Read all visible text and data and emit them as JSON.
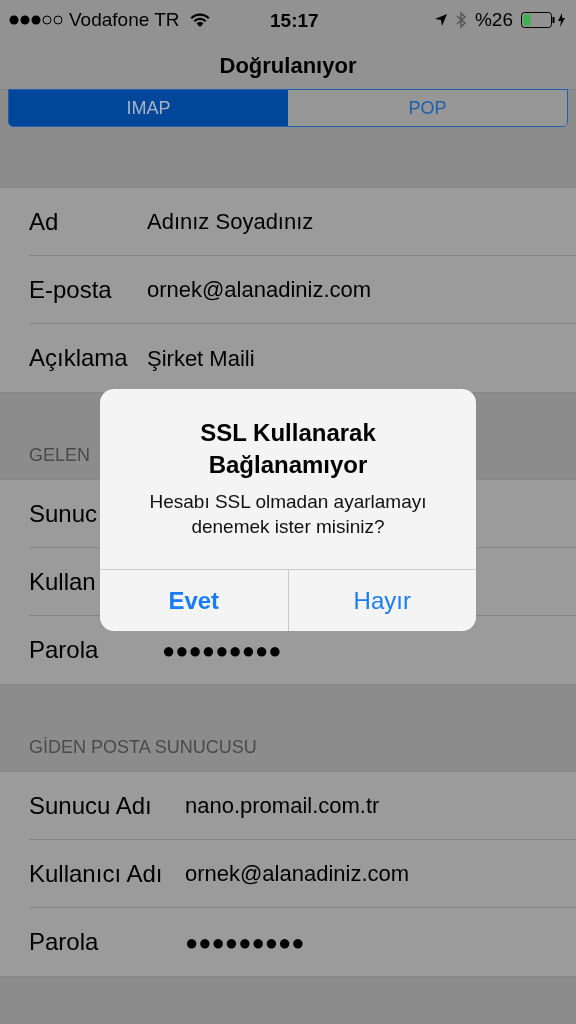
{
  "status_bar": {
    "carrier": "Vodafone TR",
    "time": "15:17",
    "battery": "%26"
  },
  "nav": {
    "title": "Doğrulanıyor"
  },
  "segments": [
    {
      "label": "IMAP",
      "selected": true
    },
    {
      "label": "POP",
      "selected": false
    }
  ],
  "sections": [
    {
      "rows": [
        {
          "label": "Ad",
          "value": "Adınız Soyadınız"
        },
        {
          "label": "E-posta",
          "value": "ornek@alanadiniz.com"
        },
        {
          "label": "Açıklama",
          "value": "Şirket Maili"
        }
      ]
    },
    {
      "header": "GELEN",
      "rows": [
        {
          "label": "Sunuc"
        },
        {
          "label": "Kullan"
        },
        {
          "label": "Parola",
          "value": "●●●●●●●●●"
        }
      ]
    },
    {
      "header": "GİDEN POSTA SUNUCUSU",
      "rows": [
        {
          "label": "Sunucu Adı",
          "value": "nano.promail.com.tr"
        },
        {
          "label": "Kullanıcı Adı",
          "value": "ornek@alanadiniz.com"
        },
        {
          "label": "Parola",
          "value": "●●●●●●●●●"
        }
      ]
    }
  ],
  "alert": {
    "title": "SSL Kullanarak Bağlanamıyor",
    "message": "Hesabı SSL olmadan ayarlamayı denemek ister misiniz?",
    "buttons": [
      {
        "label": "Evet",
        "bold": true
      },
      {
        "label": "Hayır",
        "bold": false
      }
    ]
  }
}
